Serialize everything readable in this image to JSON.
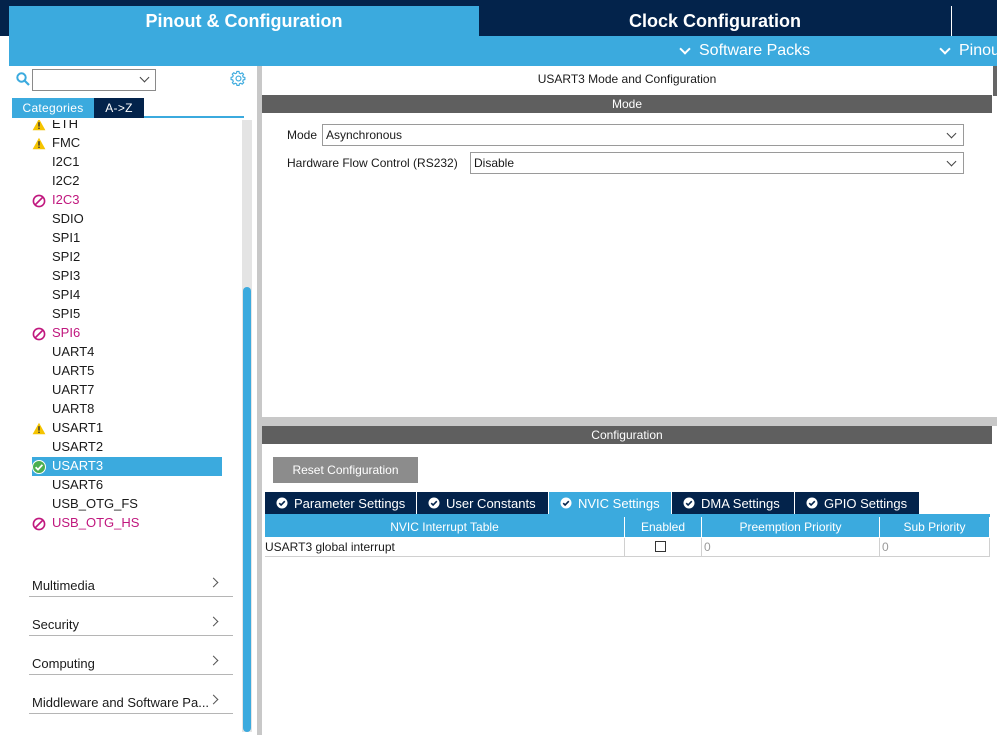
{
  "top_tabs": {
    "pinout": "Pinout & Configuration",
    "clock": "Clock Configuration"
  },
  "subbar": {
    "software_packs": "Software Packs",
    "pinout": "Pinout"
  },
  "left": {
    "search_value": "",
    "category_tabs": [
      "Categories",
      "A->Z"
    ],
    "peripherals": [
      {
        "label": "ETH",
        "status": "warning"
      },
      {
        "label": "FMC",
        "status": "warning"
      },
      {
        "label": "I2C1",
        "status": "none"
      },
      {
        "label": "I2C2",
        "status": "none"
      },
      {
        "label": "I2C3",
        "status": "disabled"
      },
      {
        "label": "SDIO",
        "status": "none"
      },
      {
        "label": "SPI1",
        "status": "none"
      },
      {
        "label": "SPI2",
        "status": "none"
      },
      {
        "label": "SPI3",
        "status": "none"
      },
      {
        "label": "SPI4",
        "status": "none"
      },
      {
        "label": "SPI5",
        "status": "none"
      },
      {
        "label": "SPI6",
        "status": "disabled"
      },
      {
        "label": "UART4",
        "status": "none"
      },
      {
        "label": "UART5",
        "status": "none"
      },
      {
        "label": "UART7",
        "status": "none"
      },
      {
        "label": "UART8",
        "status": "none"
      },
      {
        "label": "USART1",
        "status": "warning"
      },
      {
        "label": "USART2",
        "status": "none"
      },
      {
        "label": "USART3",
        "status": "ok"
      },
      {
        "label": "USART6",
        "status": "none"
      },
      {
        "label": "USB_OTG_FS",
        "status": "none"
      },
      {
        "label": "USB_OTG_HS",
        "status": "disabled"
      }
    ],
    "selected_peripheral": "USART3",
    "categories": [
      "Multimedia",
      "Security",
      "Computing",
      "Middleware and Software Pa..."
    ]
  },
  "mode_panel": {
    "title": "USART3 Mode and Configuration",
    "header": "Mode",
    "mode_label": "Mode",
    "mode_value": "Asynchronous",
    "hfc_label": "Hardware Flow Control (RS232)",
    "hfc_value": "Disable"
  },
  "config_panel": {
    "header": "Configuration",
    "reset_button": "Reset Configuration",
    "tabs": [
      "Parameter Settings",
      "User Constants",
      "NVIC Settings",
      "DMA Settings",
      "GPIO Settings"
    ],
    "active_tab": "NVIC Settings",
    "table": {
      "columns": [
        "NVIC Interrupt Table",
        "Enabled",
        "Preemption Priority",
        "Sub Priority"
      ],
      "rows": [
        {
          "name": "USART3 global interrupt",
          "enabled": false,
          "preemption": "0",
          "sub": "0"
        }
      ]
    }
  },
  "colors": {
    "accent_blue": "#3baade",
    "dark_navy": "#03234b",
    "header_gray": "#5f5f5f",
    "disabled_magenta": "#c0177e",
    "warning_yellow": "#f5c400",
    "ok_green": "#4caf50"
  }
}
